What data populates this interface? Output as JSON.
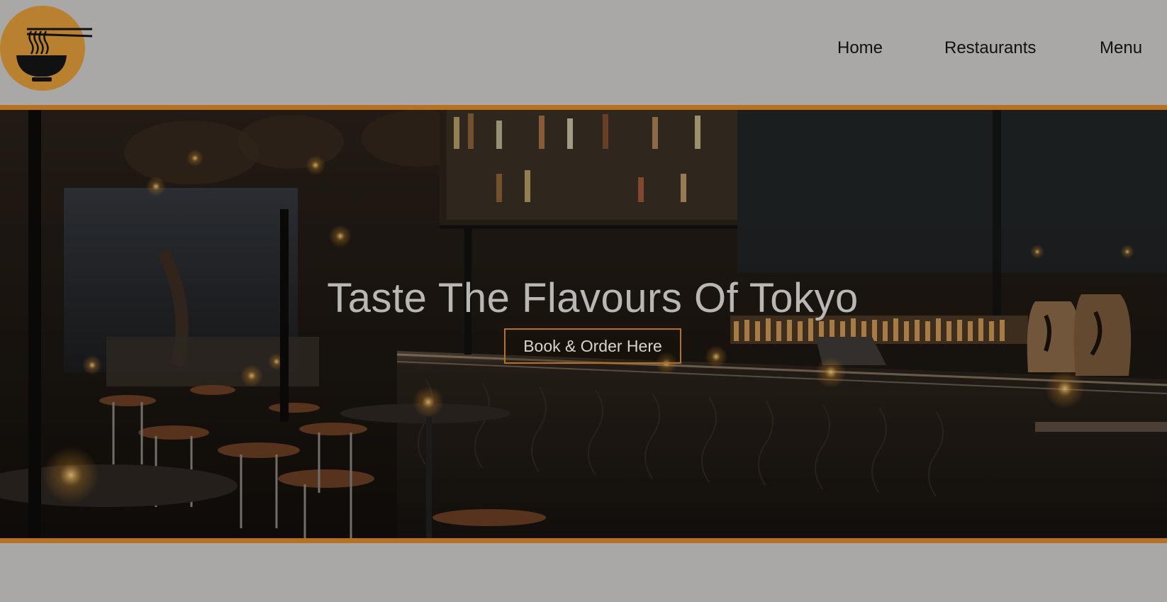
{
  "header": {
    "logo_icon": "ramen-bowl-chopsticks-icon",
    "nav": [
      {
        "label": "Home"
      },
      {
        "label": "Restaurants"
      },
      {
        "label": "Menu"
      }
    ]
  },
  "hero": {
    "background": "restaurant bar interior photo",
    "title": "Taste The Flavours Of Tokyo",
    "cta_label": "Book & Order Here"
  },
  "colors": {
    "accent": "#b8721f",
    "logo_background": "#b8802f",
    "page_background": "#a9a8a6",
    "hero_text": "#b9b7b3"
  }
}
